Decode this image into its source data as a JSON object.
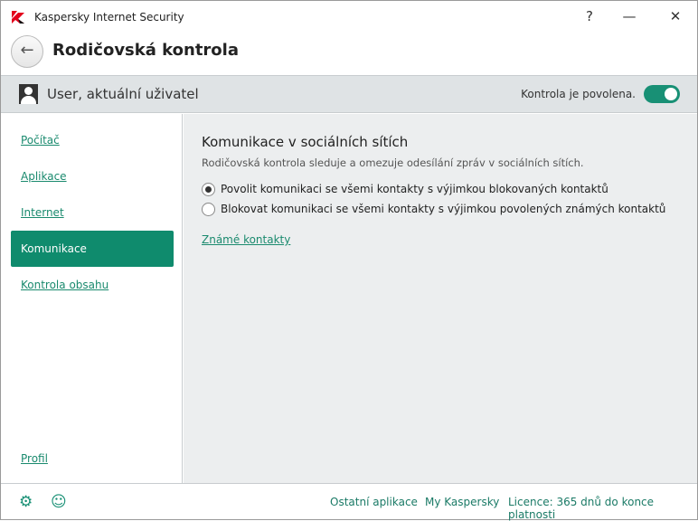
{
  "window": {
    "title": "Kaspersky Internet Security",
    "help": "?",
    "minimize": "—",
    "close": "✕"
  },
  "header": {
    "title": "Rodičovská kontrola",
    "back_icon": "←"
  },
  "userbar": {
    "user": "User, aktuální uživatel",
    "status": "Kontrola je povolena.",
    "toggle_on": true
  },
  "sidebar": {
    "items": [
      {
        "label": "Počítač"
      },
      {
        "label": "Aplikace"
      },
      {
        "label": "Internet"
      },
      {
        "label": "Komunikace",
        "active": true
      },
      {
        "label": "Kontrola obsahu"
      }
    ],
    "profile": "Profil"
  },
  "main": {
    "heading": "Komunikace v sociálních sítích",
    "description": "Rodičovská kontrola sleduje a omezuje odesílání zpráv v sociálních sítích.",
    "options": [
      {
        "label": "Povolit komunikaci se všemi kontakty s výjimkou blokovaných kontaktů",
        "selected": true
      },
      {
        "label": "Blokovat komunikaci se všemi kontakty s výjimkou povolených známých kontaktů",
        "selected": false
      }
    ],
    "link": "Známé kontakty"
  },
  "footer": {
    "settings_icon": "⚙",
    "support_icon": "☺",
    "links": [
      "Ostatní aplikace",
      "My Kaspersky",
      "Licence: 365 dnů do konce platnosti"
    ]
  }
}
